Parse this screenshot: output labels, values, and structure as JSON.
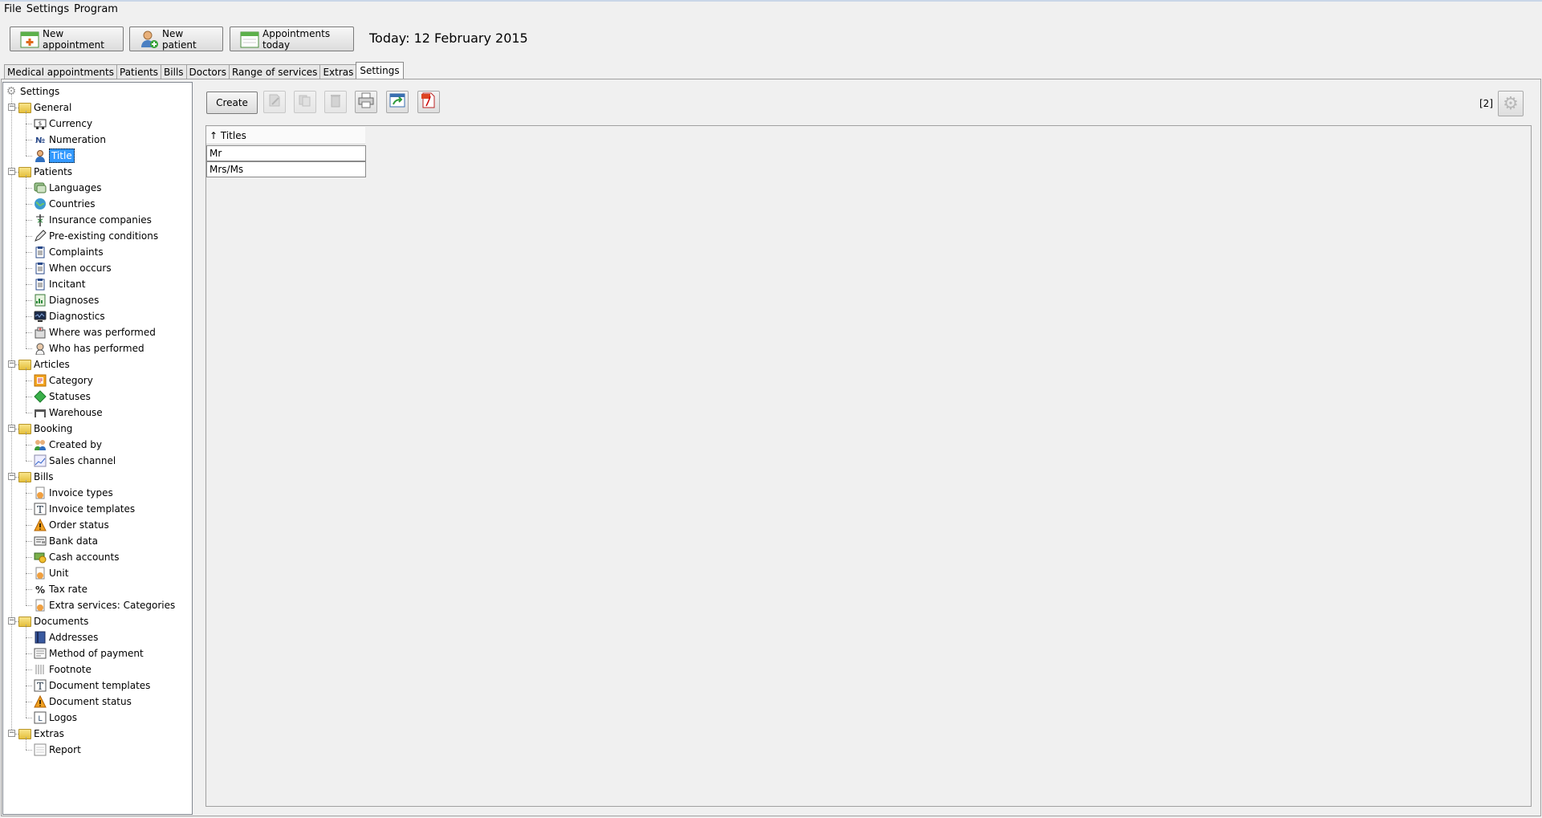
{
  "menu": [
    "File",
    "Settings",
    "Program"
  ],
  "toolbar": {
    "new_appointment": "New appointment",
    "new_patient": "New patient",
    "appointments_today": "Appointments today",
    "today": "Today: 12 February 2015"
  },
  "tabs": [
    "Medical appointments",
    "Patients",
    "Bills",
    "Doctors",
    "Range of services",
    "Extras",
    "Settings"
  ],
  "active_tab": "Settings",
  "tree": {
    "root": "Settings",
    "groups": [
      {
        "label": "General",
        "items": [
          {
            "label": "Currency",
            "icon": "currency-icon"
          },
          {
            "label": "Numeration",
            "icon": "numero-icon"
          },
          {
            "label": "Title",
            "icon": "person-icon",
            "selected": true
          }
        ]
      },
      {
        "label": "Patients",
        "items": [
          {
            "label": "Languages",
            "icon": "languages-icon"
          },
          {
            "label": "Countries",
            "icon": "globe-icon"
          },
          {
            "label": "Insurance companies",
            "icon": "caduceus-icon"
          },
          {
            "label": "Pre-existing conditions",
            "icon": "pen-icon"
          },
          {
            "label": "Complaints",
            "icon": "clipboard-icon"
          },
          {
            "label": "When occurs",
            "icon": "clipboard-icon"
          },
          {
            "label": "Incitant",
            "icon": "clipboard-icon"
          },
          {
            "label": "Diagnoses",
            "icon": "chart-sheet-icon"
          },
          {
            "label": "Diagnostics",
            "icon": "monitor-icon"
          },
          {
            "label": "Where was performed",
            "icon": "hospital-icon"
          },
          {
            "label": "Who has performed",
            "icon": "doctor-icon"
          }
        ]
      },
      {
        "label": "Articles",
        "items": [
          {
            "label": "Category",
            "icon": "category-icon"
          },
          {
            "label": "Statuses",
            "icon": "diamond-icon"
          },
          {
            "label": "Warehouse",
            "icon": "warehouse-icon"
          }
        ]
      },
      {
        "label": "Booking",
        "items": [
          {
            "label": "Created by",
            "icon": "users-icon"
          },
          {
            "label": "Sales channel",
            "icon": "channel-icon"
          }
        ]
      },
      {
        "label": "Bills",
        "items": [
          {
            "label": "Invoice types",
            "icon": "invoice-icon"
          },
          {
            "label": "Invoice templates",
            "icon": "template-icon"
          },
          {
            "label": "Order status",
            "icon": "warning-icon"
          },
          {
            "label": "Bank data",
            "icon": "bank-icon"
          },
          {
            "label": "Cash accounts",
            "icon": "cash-icon"
          },
          {
            "label": "Unit",
            "icon": "unit-icon"
          },
          {
            "label": "Tax rate",
            "icon": "percent-icon"
          },
          {
            "label": "Extra services: Categories",
            "icon": "services-icon"
          }
        ]
      },
      {
        "label": "Documents",
        "items": [
          {
            "label": "Addresses",
            "icon": "address-book-icon"
          },
          {
            "label": "Method of payment",
            "icon": "payment-icon"
          },
          {
            "label": "Footnote",
            "icon": "footnote-icon"
          },
          {
            "label": "Document templates",
            "icon": "template-icon"
          },
          {
            "label": "Document status",
            "icon": "warning-icon"
          },
          {
            "label": "Logos",
            "icon": "logo-icon"
          }
        ]
      },
      {
        "label": "Extras",
        "items": [
          {
            "label": "Report",
            "icon": "report-icon"
          }
        ]
      }
    ]
  },
  "content": {
    "create_label": "Create",
    "count": "[2]",
    "column_header": "↑ Titles",
    "rows": [
      "Mr",
      "Mrs/Ms"
    ]
  }
}
